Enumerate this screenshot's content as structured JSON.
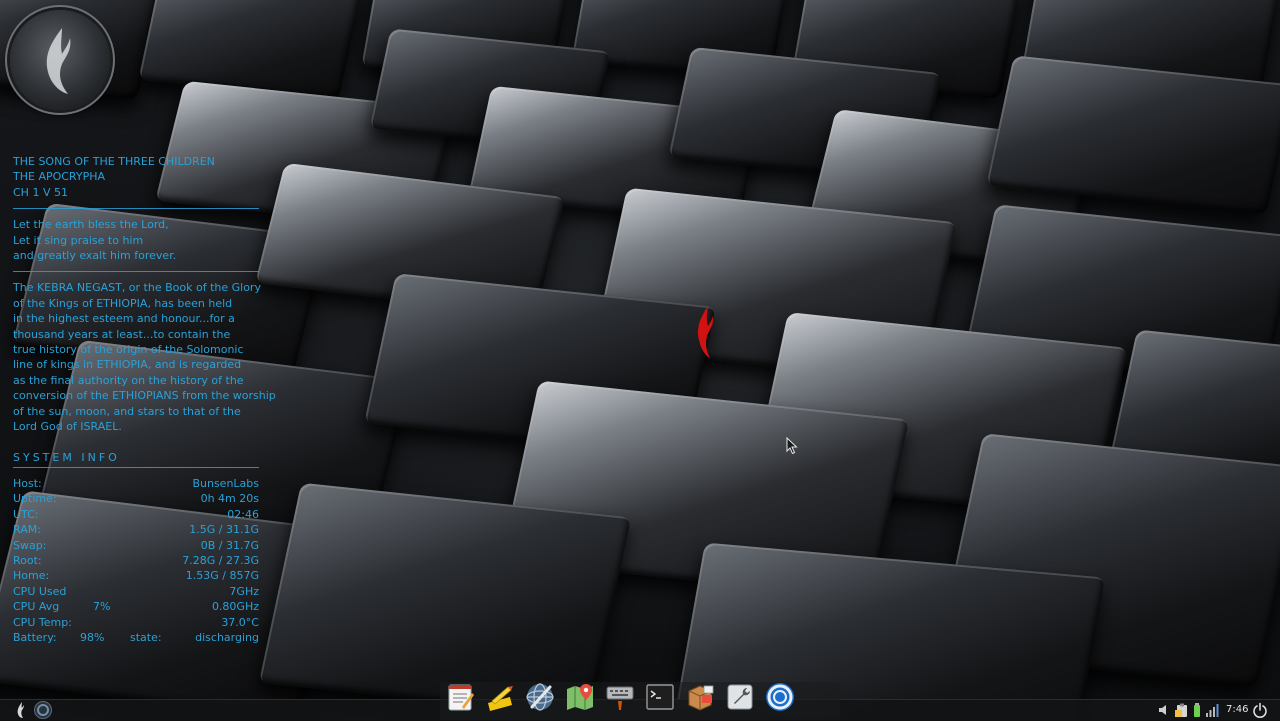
{
  "conky": {
    "header": [
      "THE SONG OF THE THREE CHILDREN",
      "THE APOCRYPHA",
      "CH 1 V 51"
    ],
    "verse": [
      "Let the earth bless the Lord,",
      "Let it sing praise to him",
      "and greatly exalt him forever."
    ],
    "paragraph": [
      "The KEBRA NEGAST, or the Book of the Glory",
      "of the Kings of ETHIOPIA, has been held",
      "in the highest esteem and honour...for a",
      "thousand years at least...to contain the",
      "true history of the origin of the Solomonic",
      "line of kings in ETHIOPIA, and is regarded",
      "as the final authority on the history of the",
      "conversion of the ETHIOPIANS from the worship",
      "of the sun, moon, and stars to that of the",
      "Lord God of ISRAEL."
    ],
    "system_title": "SYSTEM INFO",
    "system": [
      {
        "key": "Host:",
        "value": "BunsenLabs"
      },
      {
        "key": "Uptime:",
        "value": "0h 4m 20s"
      },
      {
        "key": "UTC:",
        "value": "02:46"
      },
      {
        "key": "RAM:",
        "value": "1.5G / 31.1G"
      },
      {
        "key": "Swap:",
        "value": "0B / 31.7G"
      },
      {
        "key": "Root:",
        "value": "7.28G / 27.3G"
      },
      {
        "key": "Home:",
        "value": "1.53G / 857G"
      },
      {
        "key": "CPU Used",
        "value": "7GHz"
      }
    ],
    "cpu_avg": {
      "key": "CPU Avg",
      "mid": "7%",
      "value": "0.80GHz"
    },
    "cpu_temp": {
      "key": "CPU Temp:",
      "value": "37.0°C"
    },
    "battery": {
      "key": "Battery:",
      "mid": "98%",
      "label": "state:",
      "value": "discharging"
    }
  },
  "dock": {
    "icons": [
      "text-editor-icon",
      "notes-icon",
      "web-browser-icon",
      "maps-icon",
      "keyboard-settings-icon",
      "terminal-icon",
      "package-manager-icon",
      "settings-tool-icon",
      "chromium-icon"
    ]
  },
  "taskbar": {
    "clock": "7:46"
  },
  "colors": {
    "conky_text": "#2aa1d7",
    "taskbar_bg": "#121315"
  }
}
